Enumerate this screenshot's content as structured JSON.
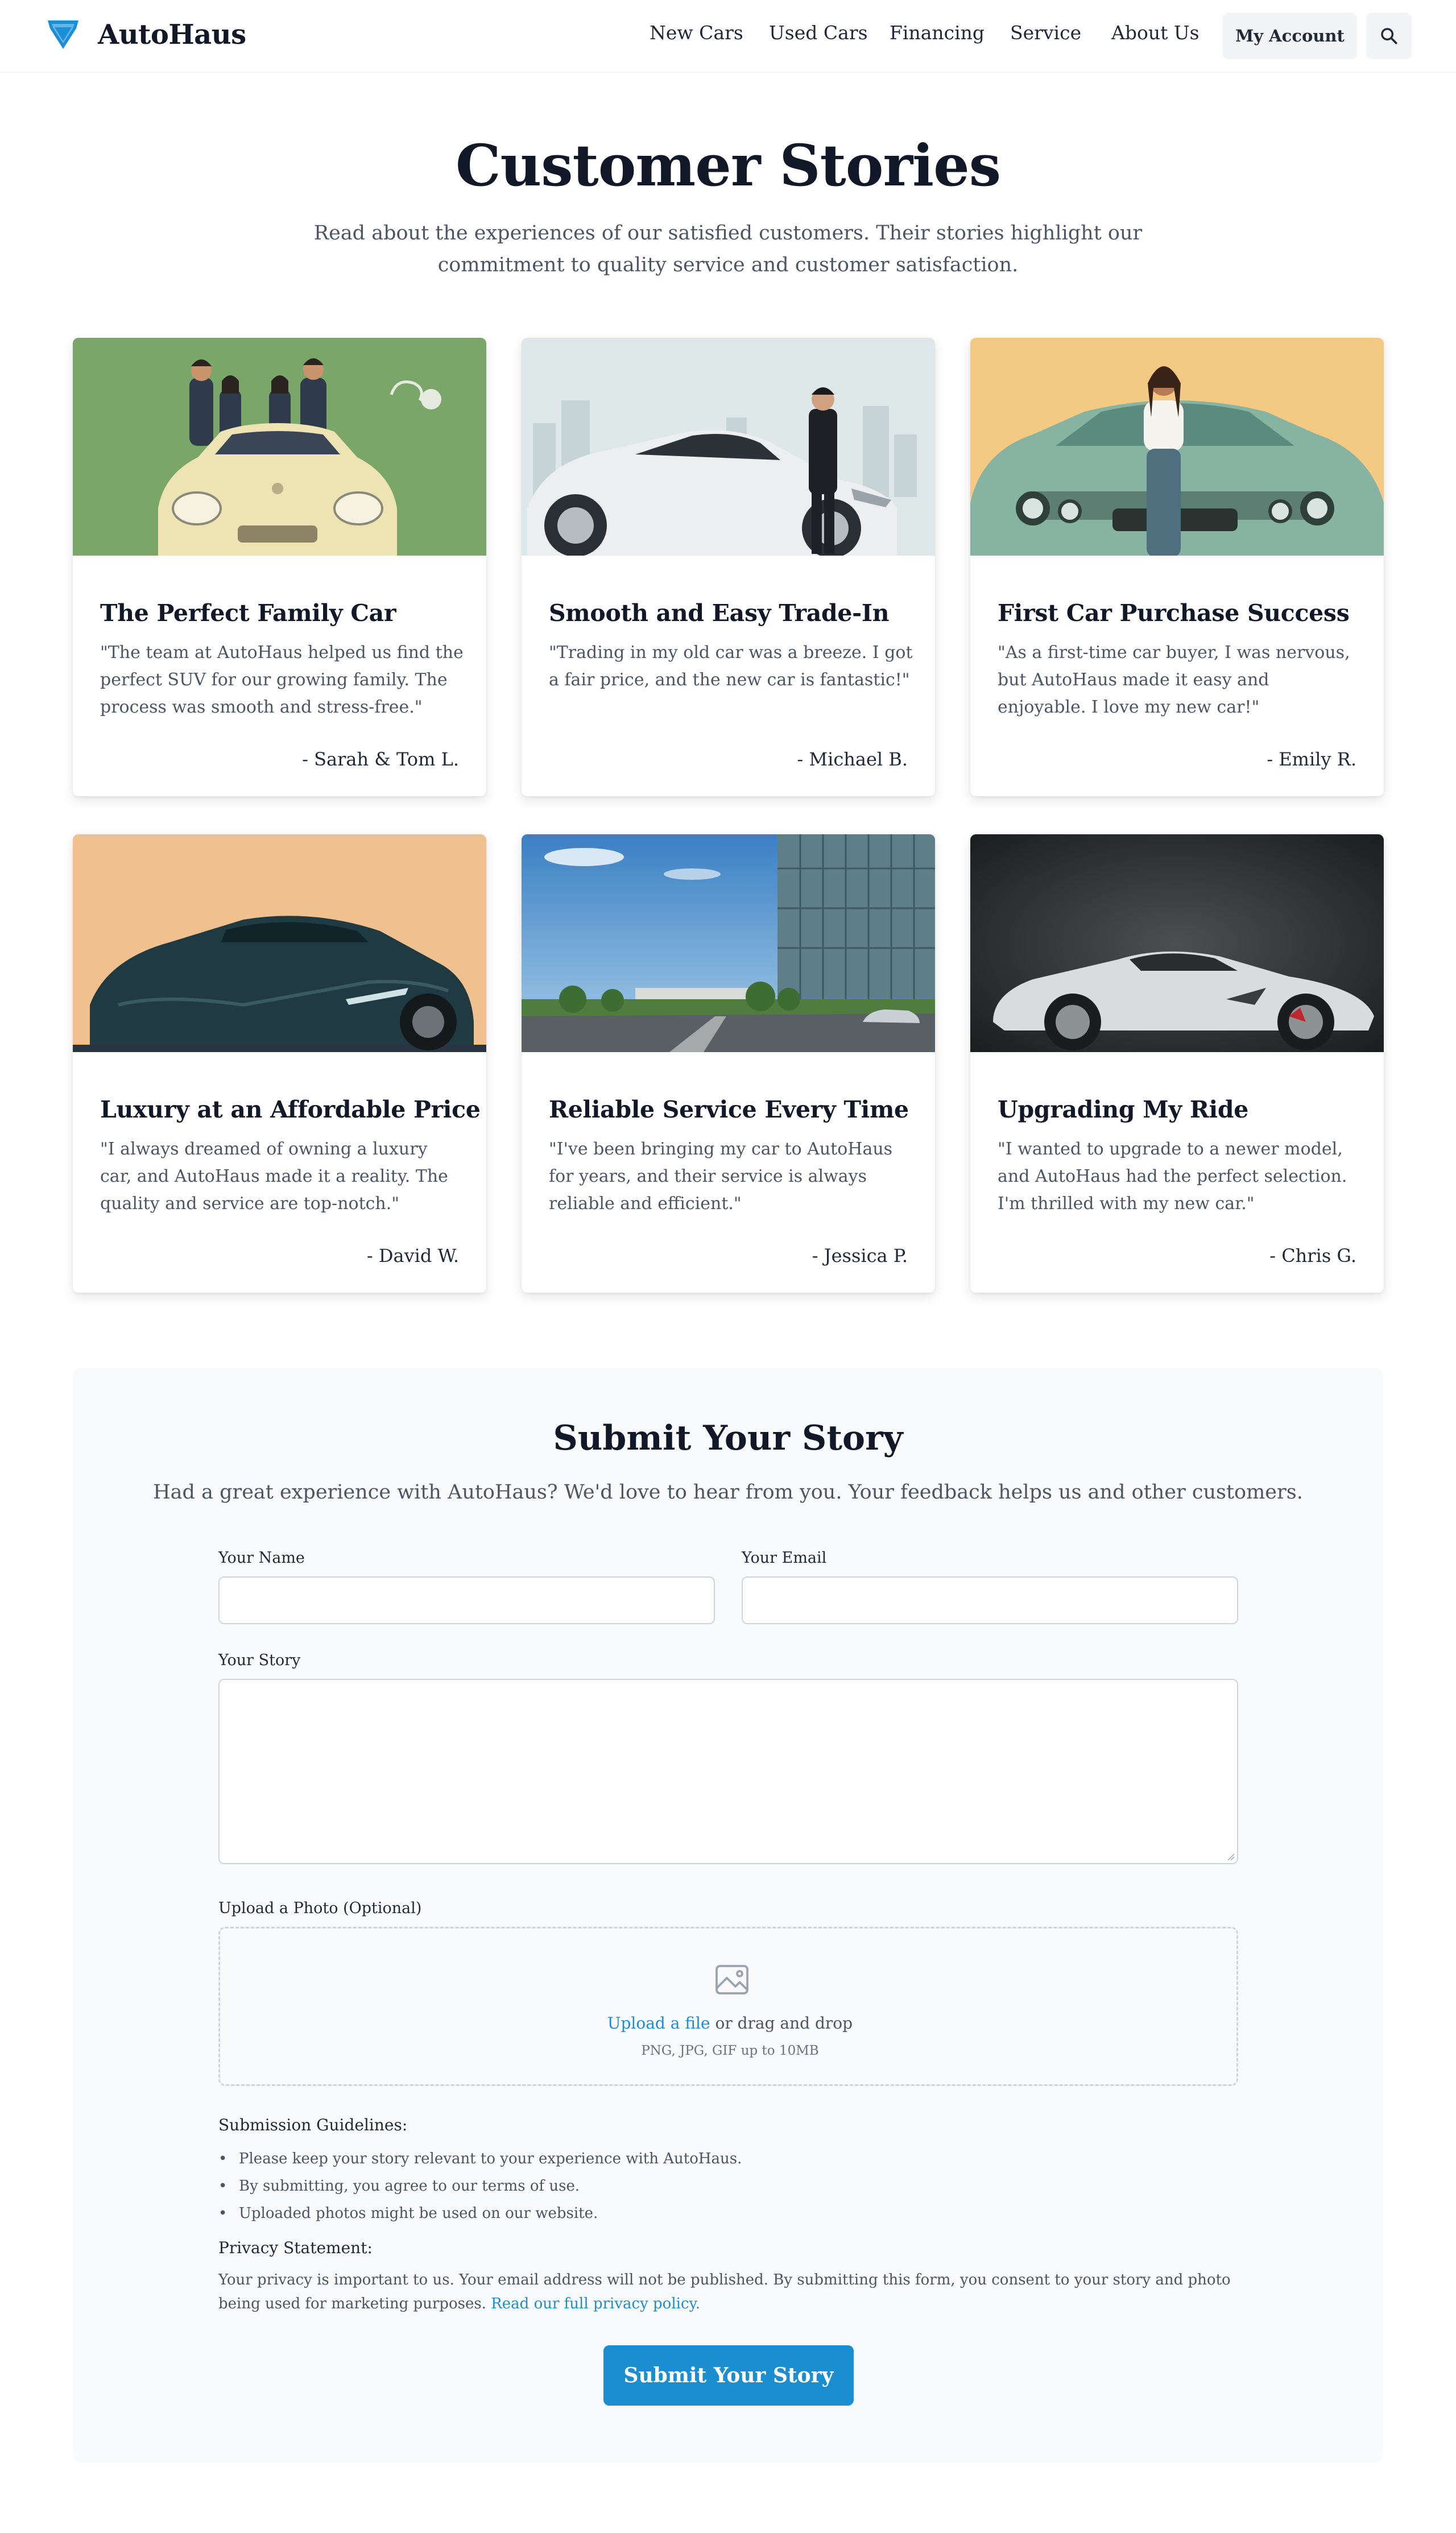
{
  "header": {
    "brand": "AutoHaus",
    "nav": [
      "New Cars",
      "Used Cars",
      "Financing",
      "Service",
      "About Us"
    ],
    "account_label": "My Account"
  },
  "hero": {
    "title": "Customer Stories",
    "subtitle": "Read about the experiences of our satisfied customers. Their stories highlight our commitment to quality service and customer satisfaction."
  },
  "stories": [
    {
      "title": "The Perfect Family Car",
      "quote": "\"The team at AutoHaus helped us find the perfect SUV for our growing family. The process was smooth and stress-free.\"",
      "author": "- Sarah & Tom L."
    },
    {
      "title": "Smooth and Easy Trade-In",
      "quote": "\"Trading in my old car was a breeze. I got a fair price, and the new car is fantastic!\"",
      "author": "- Michael B."
    },
    {
      "title": "First Car Purchase Success",
      "quote": "\"As a first-time car buyer, I was nervous, but AutoHaus made it easy and enjoyable. I love my new car!\"",
      "author": "- Emily R."
    },
    {
      "title": "Luxury at an Affordable Price",
      "quote": "\"I always dreamed of owning a luxury car, and AutoHaus made it a reality. The quality and service are top-notch.\"",
      "author": "- David W."
    },
    {
      "title": "Reliable Service Every Time",
      "quote": "\"I've been bringing my car to AutoHaus for years, and their service is always reliable and efficient.\"",
      "author": "- Jessica P."
    },
    {
      "title": "Upgrading My Ride",
      "quote": "\"I wanted to upgrade to a newer model, and AutoHaus had the perfect selection. I'm thrilled with my new car.\"",
      "author": "- Chris G."
    }
  ],
  "form": {
    "title": "Submit Your Story",
    "subtitle": "Had a great experience with AutoHaus? We'd love to hear from you. Your feedback helps us and other customers.",
    "name_label": "Your Name",
    "name_value": "",
    "email_label": "Your Email",
    "email_value": "",
    "story_label": "Your Story",
    "story_value": "",
    "upload_label": "Upload a Photo (Optional)",
    "upload_link": "Upload a file",
    "upload_text": " or drag and drop",
    "upload_hint": "PNG, JPG, GIF up to 10MB",
    "guidelines_heading": "Submission Guidelines:",
    "guidelines": [
      "Please keep your story relevant to your experience with AutoHaus.",
      "By submitting, you agree to our terms of use.",
      "Uploaded photos might be used on our website."
    ],
    "privacy_heading": "Privacy Statement:",
    "privacy_text": "Your privacy is important to us. Your email address will not be published. By submitting this form, you consent to your story and photo being used for marketing purposes. ",
    "privacy_link": "Read our full privacy policy.",
    "submit_label": "Submit Your Story"
  },
  "colors": {
    "accent": "#1b8ed2",
    "link": "#1d8dd0",
    "logo": "#1a8fd6"
  }
}
